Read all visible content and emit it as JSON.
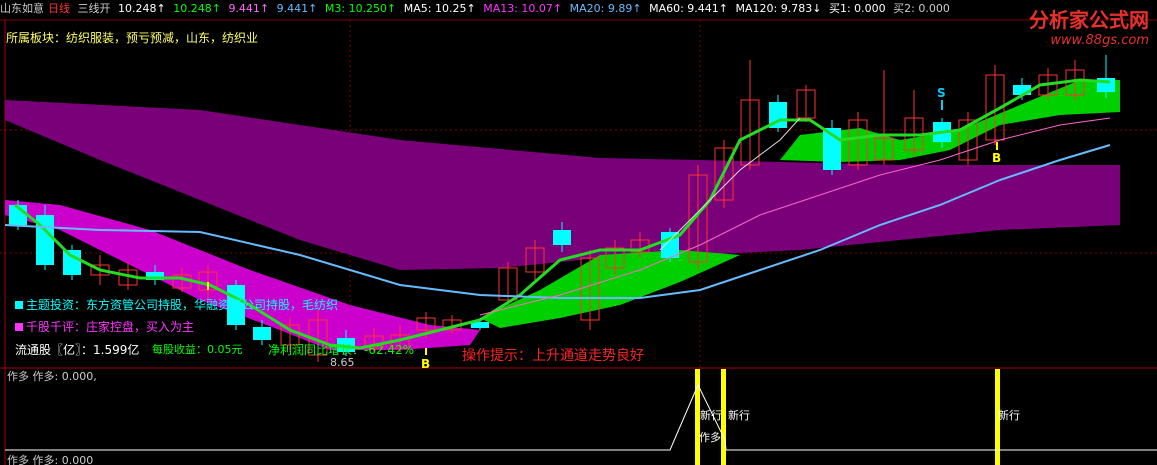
{
  "header": {
    "stock": "山东如意",
    "period": "日线",
    "indicator": "三线开",
    "v1": "10.248↑",
    "v2": "10.248↑",
    "v3": "9.441↑",
    "v4": "9.441↑",
    "m3": "M3: 10.250↑",
    "ma5": "MA5: 10.25↑",
    "ma13": "MA13: 10.07↑",
    "ma20": "MA20: 9.89↑",
    "ma60": "MA60: 9.441↑",
    "ma120": "MA120: 9.783↓",
    "buy1": "买1: 0.000",
    "buy2": "买2: 0.000"
  },
  "sector": "所属板块：纺织服装，预亏预减，山东，纺织业",
  "theme": "主题投资：东方资管公司持股，华融资管公司持股，毛纺织",
  "review": "千股千评：庄家控盘，买入为主",
  "float_shares": "流通股〖亿〗：1.599亿",
  "eps": "每股收益：0.05元",
  "profit": "净利润同比增长：-62.42%",
  "low_price": "8.65",
  "tip": "操作提示：上升通道走势良好",
  "markers": {
    "s": "S",
    "b": "B"
  },
  "sub": {
    "title": "作多 作多: 0.000,",
    "title2": "作多 作多: 0.000",
    "new_label": "新行",
    "zuo_label": "作多"
  },
  "logo": {
    "text": "分析家公式网",
    "url": "www.88gs.com"
  },
  "colors": {
    "up": "#ff3333",
    "down": "#00ffff",
    "green": "#00e000",
    "purple": "#7a007a",
    "magenta": "#cc00cc",
    "lightblue": "#66bbff",
    "yellow": "#ffff00"
  }
}
